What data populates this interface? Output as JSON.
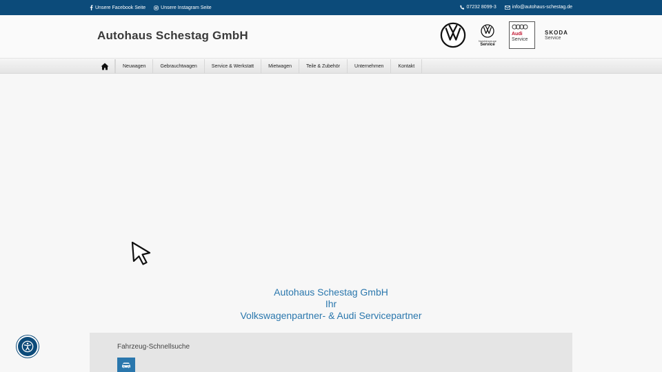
{
  "topbar": {
    "facebook_label": "Unsere Facebook Seite",
    "instagram_label": "Unsere Instagram Seite",
    "phone": "07232 8099-3",
    "email": "info@autohaus-schestag.de"
  },
  "header": {
    "brand": "Autohaus Schestag GmbH",
    "logos": {
      "vwn_line1": "Nutzfahrzeuge",
      "vwn_line2": "Service",
      "audi_line1": "Audi",
      "audi_line2": "Service",
      "skoda_line1": "SKODA",
      "skoda_line2": "Service"
    }
  },
  "nav": {
    "home_icon": "home-icon",
    "items": [
      "Neuwagen",
      "Gebrauchtwagen",
      "Service & Werkstatt",
      "Mietwagen",
      "Teile & Zubehör",
      "Unternehmen",
      "Kontakt"
    ]
  },
  "hero": {
    "line1": "Autohaus Schestag GmbH",
    "line2": "Ihr",
    "line3": "Volkswagenpartner- & Audi Servicepartner"
  },
  "search": {
    "title": "Fahrzeug-Schnellsuche",
    "car_icon": "car-icon"
  },
  "colors": {
    "topbar": "#0c4b7a",
    "accent": "#2a77ad",
    "audi_red": "#c0102b"
  }
}
